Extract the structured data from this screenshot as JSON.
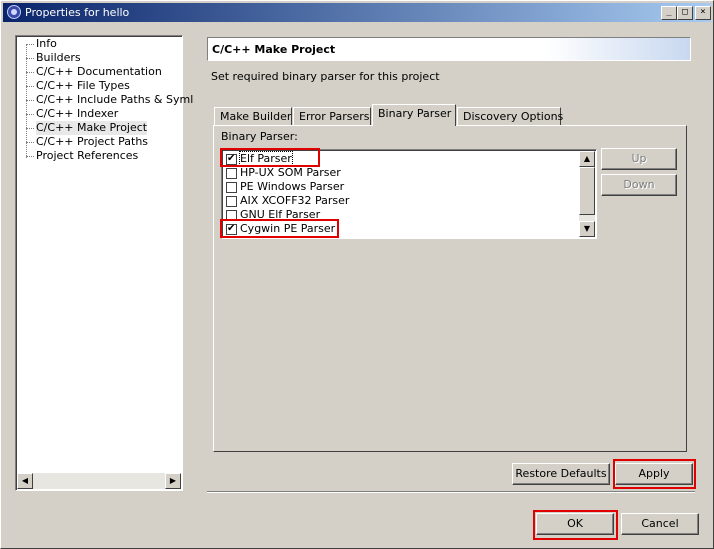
{
  "window": {
    "title": "Properties for hello",
    "min_glyph": "_",
    "max_glyph": "□",
    "close_glyph": "×"
  },
  "tree": {
    "items": [
      {
        "label": "Info"
      },
      {
        "label": "Builders"
      },
      {
        "label": "C/C++ Documentation"
      },
      {
        "label": "C/C++ File Types"
      },
      {
        "label": "C/C++ Include Paths & Syml"
      },
      {
        "label": "C/C++ Indexer"
      },
      {
        "label": "C/C++ Make Project",
        "selected": true
      },
      {
        "label": "C/C++ Project Paths"
      },
      {
        "label": "Project References"
      }
    ],
    "scroll_left": "◀",
    "scroll_right": "▶"
  },
  "page": {
    "title": "C/C++ Make Project",
    "description": "Set required binary parser for this project"
  },
  "tabs": [
    {
      "label": "Make Builder"
    },
    {
      "label": "Error Parsers"
    },
    {
      "label": "Binary Parser",
      "active": true
    },
    {
      "label": "Discovery Options"
    }
  ],
  "binary_parser": {
    "group_label": "Binary Parser:",
    "parsers": [
      {
        "label": "Elf Parser",
        "checked": true
      },
      {
        "label": "HP-UX SOM Parser",
        "checked": false
      },
      {
        "label": "PE Windows Parser",
        "checked": false
      },
      {
        "label": "AIX XCOFF32 Parser",
        "checked": false
      },
      {
        "label": "GNU Elf Parser",
        "checked": false
      },
      {
        "label": "Cygwin PE Parser",
        "checked": true
      }
    ],
    "up_label": "Up",
    "down_label": "Down",
    "scroll_up": "▲",
    "scroll_down": "▼"
  },
  "buttons": {
    "restore_defaults": "Restore Defaults",
    "apply": "Apply",
    "ok": "OK",
    "cancel": "Cancel"
  },
  "colors": {
    "highlight": "#e00000",
    "title_bar": "#0a246a",
    "dialog_face": "#d4d0c8"
  }
}
